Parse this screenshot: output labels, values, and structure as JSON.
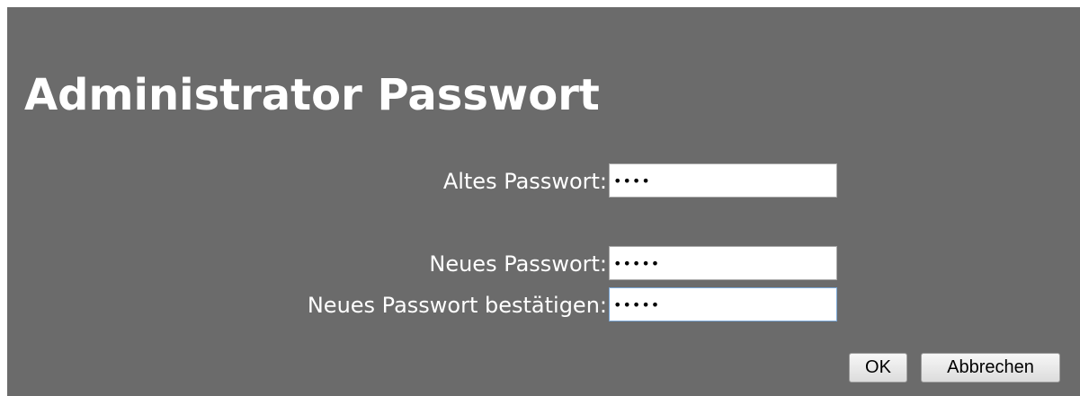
{
  "page": {
    "title": "Administrator Passwort"
  },
  "form": {
    "old_password": {
      "label": "Altes Passwort:",
      "value": "••••"
    },
    "new_password": {
      "label": "Neues Passwort:",
      "value": "•••••"
    },
    "confirm_password": {
      "label": "Neues Passwort bestätigen:",
      "value": "•••••"
    }
  },
  "buttons": {
    "ok_label": "OK",
    "cancel_label": "Abbrechen"
  },
  "colors": {
    "panel_background": "#6b6b6b",
    "text": "#ffffff",
    "input_background": "#ffffff"
  }
}
